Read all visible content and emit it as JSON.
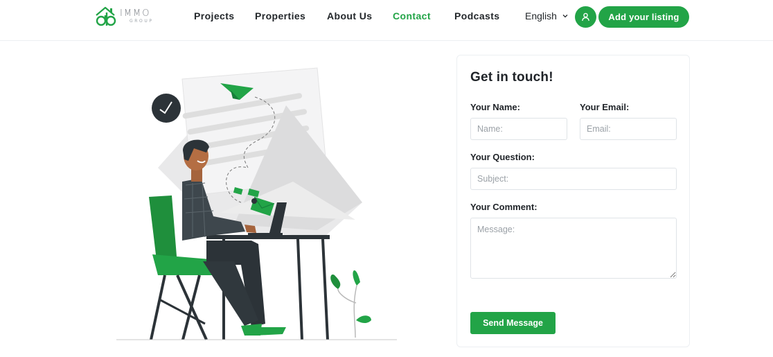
{
  "brand": {
    "logo_text": "IMMO",
    "logo_subtext": "GROUP",
    "logo_mark": "ab",
    "accent_color": "#22a447"
  },
  "nav": {
    "items": [
      {
        "label": "Projects",
        "active": false
      },
      {
        "label": "Properties",
        "active": false
      },
      {
        "label": "About Us",
        "active": false
      },
      {
        "label": "Contact",
        "active": true
      },
      {
        "label": "Podcasts",
        "active": false
      }
    ],
    "language": "English",
    "language_icon": "chevron-down-icon",
    "user_icon": "user-icon",
    "cta_label": "Add your listing"
  },
  "illustration": {
    "subject": "person-at-laptop-sending-mail",
    "icons": [
      "clock-icon",
      "paper-plane-icon",
      "envelope-icon",
      "plant-icon"
    ]
  },
  "contact_form": {
    "title": "Get in touch!",
    "name_label": "Your Name:",
    "name_placeholder": "Name:",
    "email_label": "Your Email:",
    "email_placeholder": "Email:",
    "question_label": "Your Question:",
    "question_placeholder": "Subject:",
    "comment_label": "Your Comment:",
    "comment_placeholder": "Message:",
    "submit_label": "Send Message"
  }
}
